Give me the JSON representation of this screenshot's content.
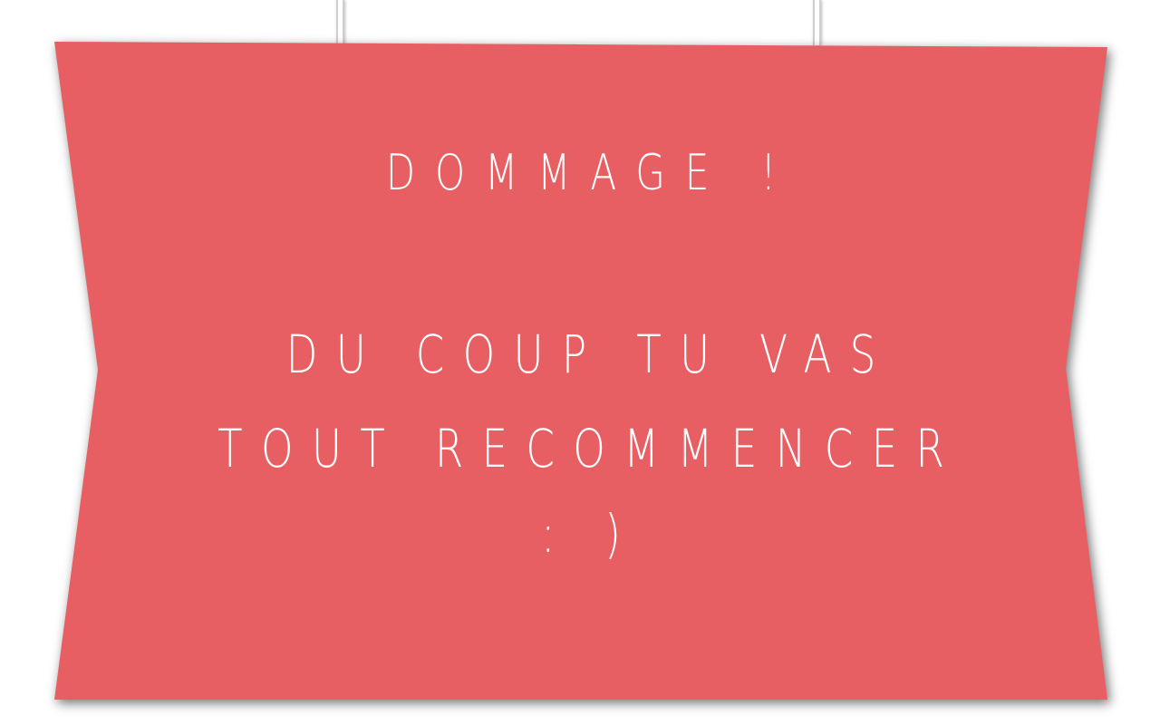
{
  "sign": {
    "color": "#e85f63",
    "title": "DOMMAGE !",
    "message_line1": "DU COUP TU VAS",
    "message_line2": "TOUT RECOMMENCER",
    "message_line3": ": )"
  }
}
